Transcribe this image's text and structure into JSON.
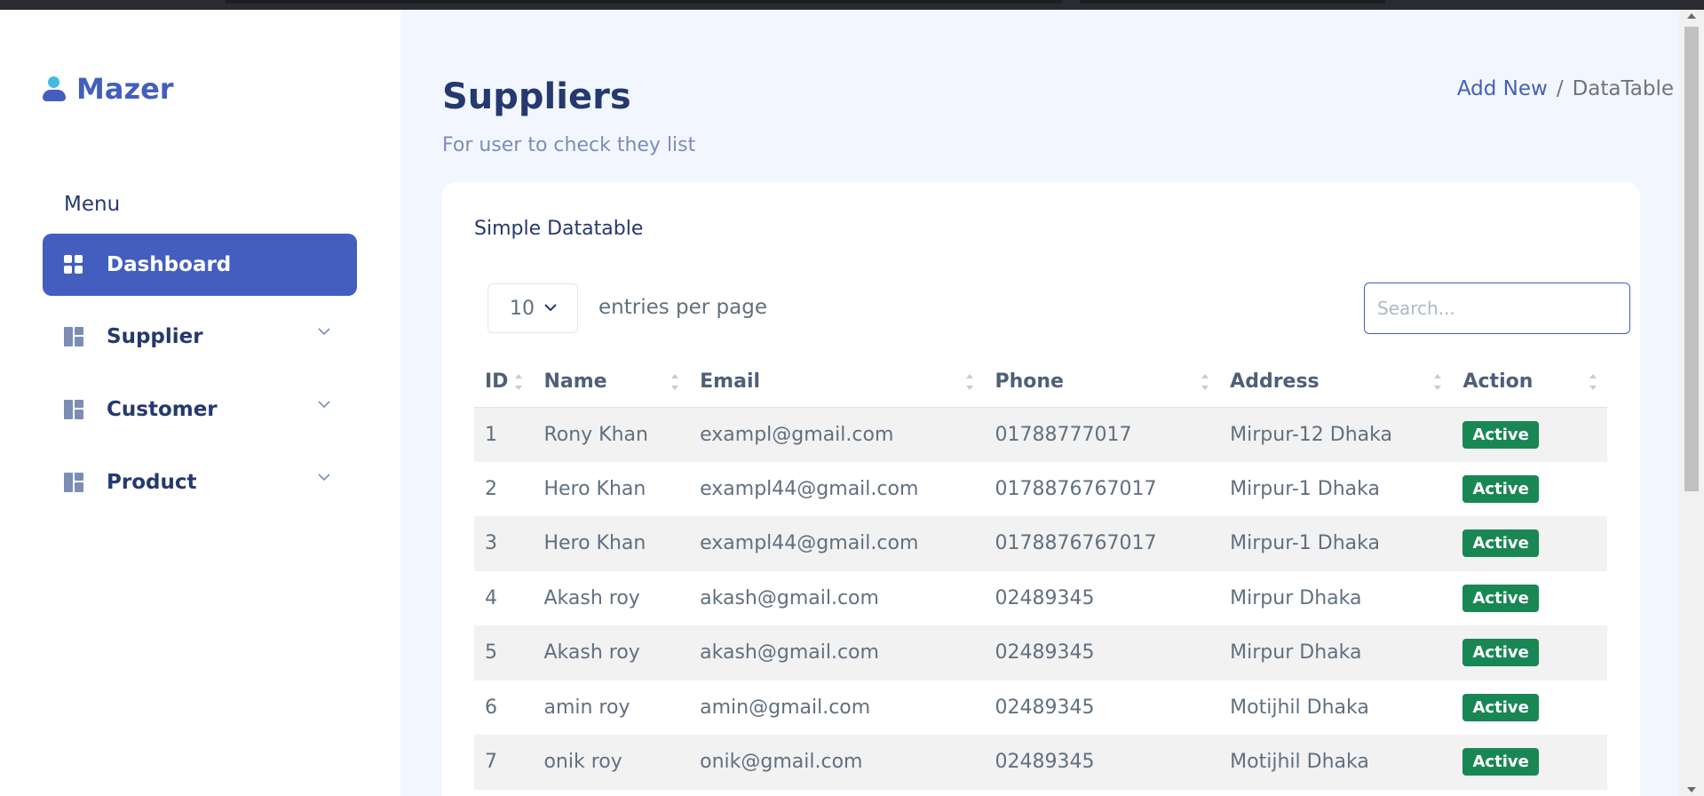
{
  "app": {
    "name": "Mazer"
  },
  "sidebar": {
    "menu_title": "Menu",
    "items": [
      {
        "label": "Dashboard",
        "icon": "grid-icon",
        "active": true
      },
      {
        "label": "Supplier",
        "icon": "layout-icon",
        "has_submenu": true
      },
      {
        "label": "Customer",
        "icon": "layout-icon",
        "has_submenu": true
      },
      {
        "label": "Product",
        "icon": "layout-icon",
        "has_submenu": true
      }
    ]
  },
  "page": {
    "title": "Suppliers",
    "subtitle": "For user to check they list",
    "breadcrumb": {
      "link": "Add New",
      "separator": "/",
      "current": "DataTable"
    }
  },
  "card": {
    "title": "Simple Datatable"
  },
  "table_controls": {
    "per_page_value": "10",
    "per_page_label": "entries per page",
    "search_placeholder": "Search..."
  },
  "table": {
    "columns": [
      "ID",
      "Name",
      "Email",
      "Phone",
      "Address",
      "Action"
    ],
    "rows": [
      {
        "id": "1",
        "name": "Rony Khan",
        "email": "exampl@gmail.com",
        "phone": "01788777017",
        "address": "Mirpur-12 Dhaka",
        "action": "Active"
      },
      {
        "id": "2",
        "name": "Hero Khan",
        "email": "exampl44@gmail.com",
        "phone": "0178876767017",
        "address": "Mirpur-1 Dhaka",
        "action": "Active"
      },
      {
        "id": "3",
        "name": "Hero Khan",
        "email": "exampl44@gmail.com",
        "phone": "0178876767017",
        "address": "Mirpur-1 Dhaka",
        "action": "Active"
      },
      {
        "id": "4",
        "name": "Akash roy",
        "email": "akash@gmail.com",
        "phone": "02489345",
        "address": "Mirpur Dhaka",
        "action": "Active"
      },
      {
        "id": "5",
        "name": "Akash roy",
        "email": "akash@gmail.com",
        "phone": "02489345",
        "address": "Mirpur Dhaka",
        "action": "Active"
      },
      {
        "id": "6",
        "name": "amin roy",
        "email": "amin@gmail.com",
        "phone": "02489345",
        "address": "Motijhil Dhaka",
        "action": "Active"
      },
      {
        "id": "7",
        "name": "onik roy",
        "email": "onik@gmail.com",
        "phone": "02489345",
        "address": "Motijhil Dhaka",
        "action": "Active"
      }
    ]
  },
  "colors": {
    "primary": "#435ebe",
    "background": "#f2f7ff",
    "success": "#198754",
    "text": "#25396f"
  }
}
